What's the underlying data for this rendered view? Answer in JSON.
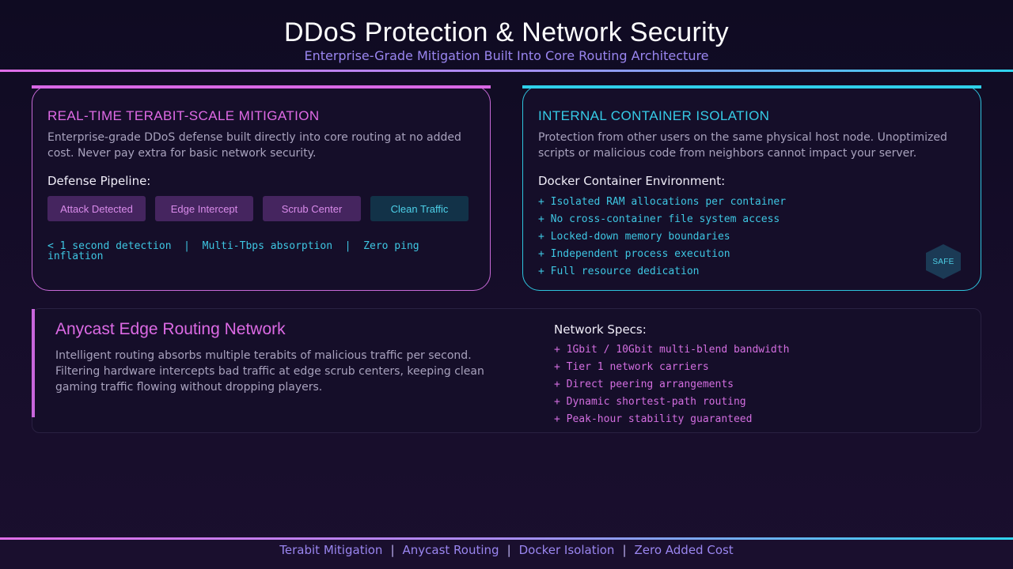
{
  "header": {
    "title": "DDoS Protection & Network Security",
    "subtitle": "Enterprise-Grade Mitigation Built Into Core Routing Architecture"
  },
  "mitigation_card": {
    "title": "REAL-TIME TERABIT-SCALE MITIGATION",
    "description": "Enterprise-grade DDoS defense built directly into core routing at no added cost. Never pay extra for basic network security.",
    "pipeline_label": "Defense Pipeline:",
    "pipeline": [
      "Attack Detected",
      "Edge Intercept",
      "Scrub Center",
      "Clean Traffic"
    ],
    "metrics": "< 1 second detection  |  Multi-Tbps absorption  |  Zero ping inflation"
  },
  "isolation_card": {
    "title": "INTERNAL CONTAINER ISOLATION",
    "description": "Protection from other users on the same physical host node. Unoptimized scripts or malicious code from neighbors cannot impact your server.",
    "list_label": "Docker Container Environment:",
    "features": [
      "+ Isolated RAM allocations per container",
      "+ No cross-container file system access",
      "+ Locked-down memory boundaries",
      "+ Independent process execution",
      "+ Full resource dedication"
    ],
    "badge": "SAFE",
    "badge_icon": "hexagon-shield-icon"
  },
  "anycast": {
    "title": "Anycast Edge Routing Network",
    "description": "Intelligent routing absorbs multiple terabits of malicious traffic per second. Filtering hardware intercepts bad traffic at edge scrub centers, keeping clean gaming traffic flowing without dropping players.",
    "specs_label": "Network Specs:",
    "specs": [
      "+ 1Gbit / 10Gbit multi-blend bandwidth",
      "+ Tier 1 network carriers",
      "+ Direct peering arrangements",
      "+ Dynamic shortest-path routing",
      "+ Peak-hour stability guaranteed"
    ]
  },
  "footer": {
    "items": [
      "Terabit Mitigation",
      "Anycast Routing",
      "Docker Isolation",
      "Zero Added Cost"
    ],
    "separator": "|"
  },
  "colors": {
    "magenta_accent": "#d868e4",
    "cyan_accent": "#2fd0ea",
    "violet_text": "#9a86f0",
    "background": "#140d28"
  }
}
